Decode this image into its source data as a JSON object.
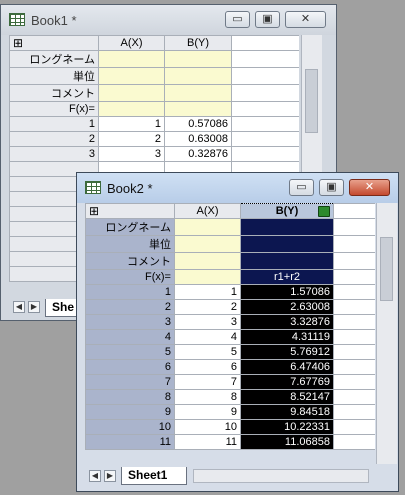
{
  "book1": {
    "title": "Book1 *",
    "controls": {
      "minimize": "▭",
      "maximize": "▣",
      "close": "✕"
    },
    "columns": [
      "A(X)",
      "B(Y)"
    ],
    "meta_labels": [
      "ロングネーム",
      "単位",
      "コメント",
      "F(x)="
    ],
    "rows": [
      {
        "row": "1",
        "a": "1",
        "b": "0.57086"
      },
      {
        "row": "2",
        "a": "2",
        "b": "0.63008"
      },
      {
        "row": "3",
        "a": "3",
        "b": "0.32876"
      }
    ],
    "sheet_tab": "She"
  },
  "book2": {
    "title": "Book2 *",
    "controls": {
      "minimize": "▭",
      "maximize": "▣",
      "close": "✕"
    },
    "columns": [
      "A(X)",
      "B(Y)"
    ],
    "meta_labels": [
      "ロングネーム",
      "単位",
      "コメント",
      "F(x)="
    ],
    "formula": "r1+r2",
    "rows": [
      {
        "row": "1",
        "a": "1",
        "b": "1.57086"
      },
      {
        "row": "2",
        "a": "2",
        "b": "2.63008"
      },
      {
        "row": "3",
        "a": "3",
        "b": "3.32876"
      },
      {
        "row": "4",
        "a": "4",
        "b": "4.31119"
      },
      {
        "row": "5",
        "a": "5",
        "b": "5.76912"
      },
      {
        "row": "6",
        "a": "6",
        "b": "6.47406"
      },
      {
        "row": "7",
        "a": "7",
        "b": "7.67769"
      },
      {
        "row": "8",
        "a": "8",
        "b": "8.52147"
      },
      {
        "row": "9",
        "a": "9",
        "b": "9.84518"
      },
      {
        "row": "10",
        "a": "10",
        "b": "10.22331"
      },
      {
        "row": "11",
        "a": "11",
        "b": "11.06858"
      }
    ],
    "sheet_tab": "Sheet1"
  },
  "corner_glyph": "⊞",
  "icons": {
    "app": "worksheet-icon",
    "lock": "column-lock-icon",
    "left": "◀",
    "right": "▶",
    "up": "▲",
    "down": "▼"
  },
  "colors": {
    "selection": "#0c1650",
    "metadata": "#fafad0",
    "header_selected_rows": "#aab4cc"
  }
}
